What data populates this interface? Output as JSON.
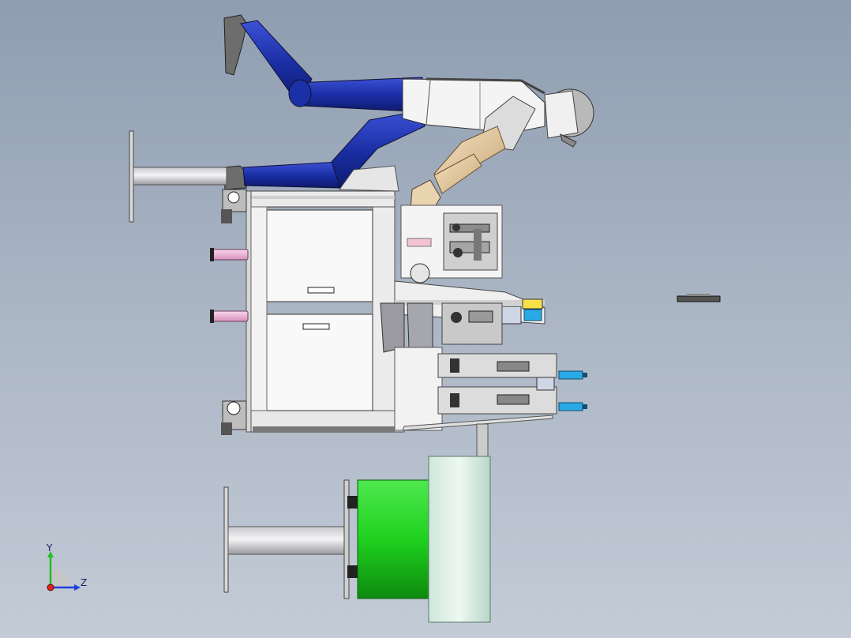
{
  "triad": {
    "y_label": "Y",
    "z_label": "Z"
  },
  "colors": {
    "background_top": "#8e9db1",
    "background_bottom": "#c3cbd6",
    "suit_blue": "#1b2fa6",
    "skin": "#e8cfa6",
    "head_grey": "#b9b9b9",
    "machine_frame": "#f2f2f2",
    "pink_cylinder": "#f2b6d8",
    "green_drum": "#1fd11f",
    "pale_drum": "#d9eee6",
    "yellow_block": "#f7e14a",
    "blue_block": "#2aa9e6"
  }
}
